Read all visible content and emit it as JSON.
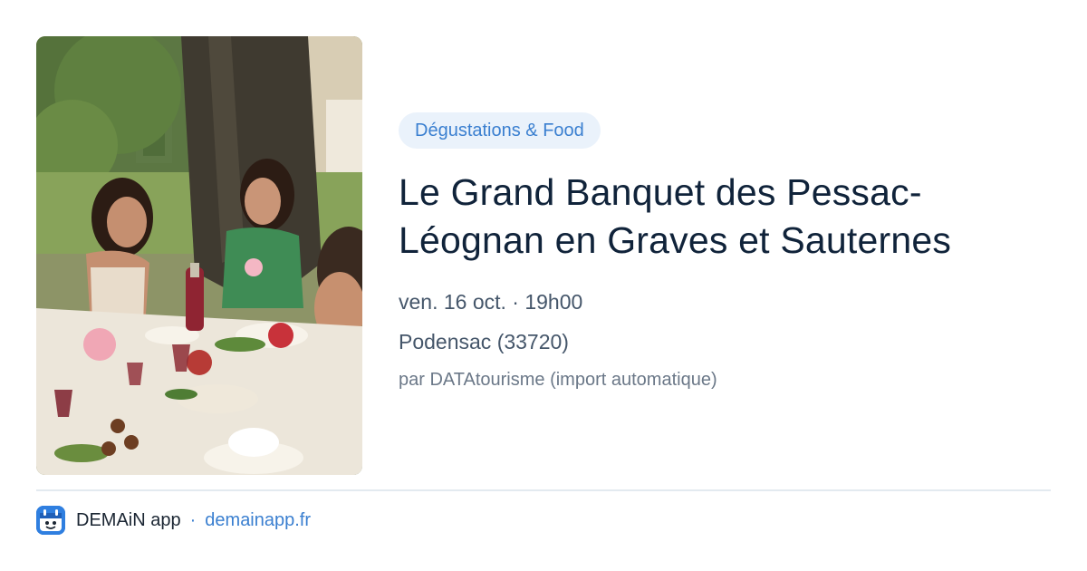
{
  "event": {
    "category": "Dégustations & Food",
    "title": "Le Grand Banquet des Pessac-Léognan en Graves et Sauternes",
    "datetime": "ven. 16 oct. · 19h00",
    "location": "Podensac (33720)",
    "source": "par DATAtourisme (import automatique)",
    "image_alt": "Convives attablés en plein air sous un arbre autour d'un banquet"
  },
  "footer": {
    "app_name": "DEMAiN app",
    "separator": "·",
    "site": "demainapp.fr",
    "icon": "demain-app-icon"
  },
  "colors": {
    "accent": "#3a7fd0",
    "category_bg": "#eaf2fb",
    "title": "#10233a",
    "meta": "#45566a",
    "divider": "#e3eaf0"
  }
}
